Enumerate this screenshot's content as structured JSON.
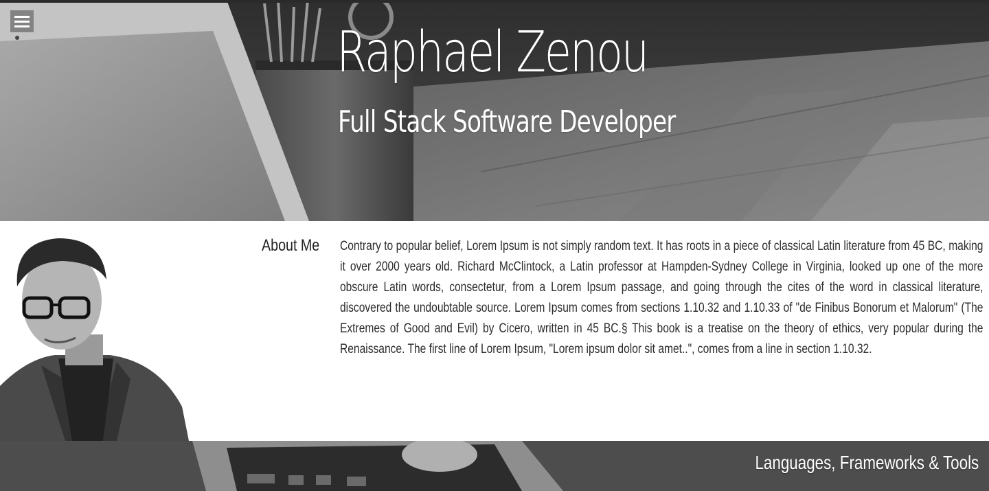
{
  "hero": {
    "name": "Raphael Zenou",
    "role": "Full Stack Software Developer",
    "menu_icon": "hamburger-menu-icon",
    "background": "grayscale desk photo"
  },
  "about": {
    "heading": "About Me",
    "body": "Contrary to popular belief, Lorem Ipsum is not simply random text. It has roots in a piece of classical Latin literature from 45 BC, making it over 2000 years old. Richard McClintock, a Latin professor at Hampden-Sydney College in Virginia, looked up one of the more obscure Latin words, consectetur, from a Lorem Ipsum passage, and going through the cites of the word in classical literature, discovered the undoubtable source. Lorem Ipsum comes from sections 1.10.32 and 1.10.33 of \"de Finibus Bonorum et Malorum\" (The Extremes of Good and Evil) by Cicero, written in 45 BC.§ This book is a treatise on the theory of ethics, very popular during the Renaissance. The first line of Lorem Ipsum, \"Lorem ipsum dolor sit amet..\", comes from a line in section 1.10.32."
  },
  "skills": {
    "heading": "Languages, Frameworks & Tools"
  },
  "colors": {
    "hero_text": "#ffffff",
    "body_text": "#2b2b2b",
    "menu_bg": "#6e6e6e"
  }
}
